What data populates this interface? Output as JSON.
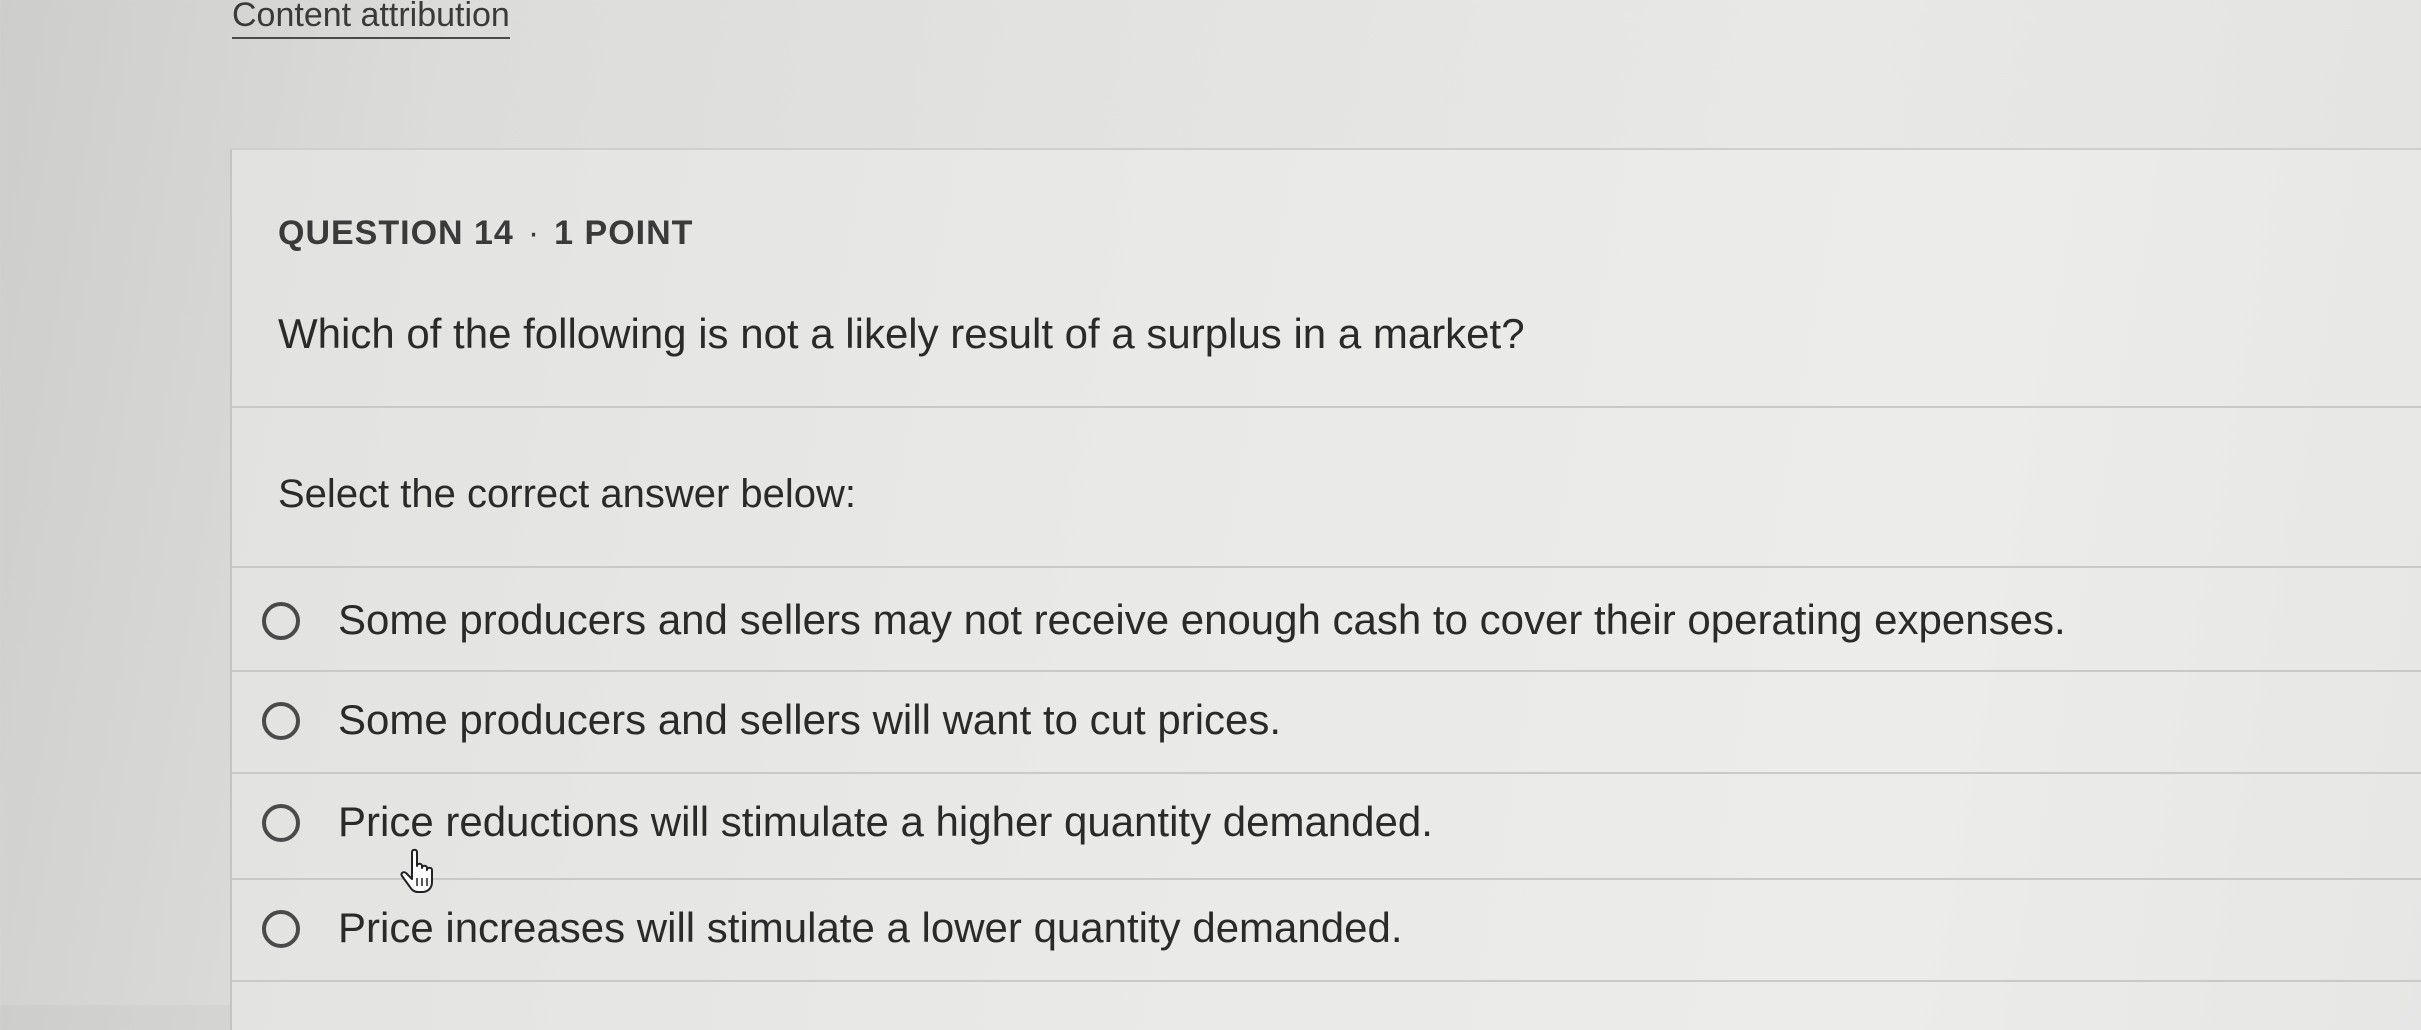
{
  "header": {
    "attribution_link": "Content attribution"
  },
  "question": {
    "number_label": "QUESTION 14",
    "separator": "·",
    "points_label": "1 POINT",
    "text": "Which of the following is not a likely result of a surplus in a market?",
    "instruction": "Select the correct answer below:"
  },
  "options": [
    {
      "label": "Some producers and sellers may not receive enough cash to cover their operating expenses.",
      "selected": false
    },
    {
      "label": "Some producers and sellers will want to cut prices.",
      "selected": false
    },
    {
      "label": "Price reductions will stimulate a higher quantity demanded.",
      "selected": false
    },
    {
      "label": "Price increases will stimulate a lower quantity demanded.",
      "selected": false
    }
  ],
  "cursor": {
    "icon": "hand-pointer-icon"
  }
}
